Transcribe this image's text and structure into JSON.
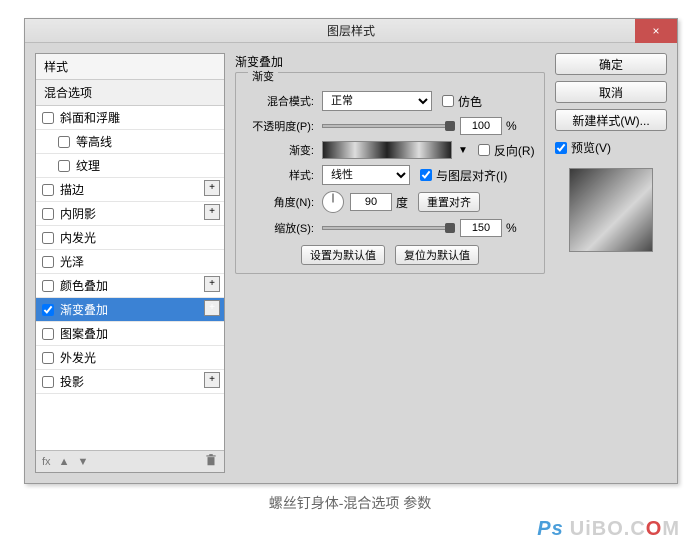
{
  "dialog": {
    "title": "图层样式",
    "close": "×"
  },
  "left": {
    "header": "样式",
    "blend": "混合选项",
    "items": [
      {
        "label": "斜面和浮雕",
        "checked": false,
        "indent": false,
        "plus": false
      },
      {
        "label": "等高线",
        "checked": false,
        "indent": true,
        "plus": false
      },
      {
        "label": "纹理",
        "checked": false,
        "indent": true,
        "plus": false
      },
      {
        "label": "描边",
        "checked": false,
        "indent": false,
        "plus": true
      },
      {
        "label": "内阴影",
        "checked": false,
        "indent": false,
        "plus": true
      },
      {
        "label": "内发光",
        "checked": false,
        "indent": false,
        "plus": false
      },
      {
        "label": "光泽",
        "checked": false,
        "indent": false,
        "plus": false
      },
      {
        "label": "颜色叠加",
        "checked": false,
        "indent": false,
        "plus": true
      },
      {
        "label": "渐变叠加",
        "checked": true,
        "indent": false,
        "plus": true,
        "selected": true
      },
      {
        "label": "图案叠加",
        "checked": false,
        "indent": false,
        "plus": false
      },
      {
        "label": "外发光",
        "checked": false,
        "indent": false,
        "plus": false
      },
      {
        "label": "投影",
        "checked": false,
        "indent": false,
        "plus": true
      }
    ],
    "footer_fx": "fx"
  },
  "mid": {
    "group_title": "渐变叠加",
    "fieldset_title": "渐变",
    "blend_mode_label": "混合模式:",
    "blend_mode_value": "正常",
    "dither_label": "仿色",
    "opacity_label": "不透明度(P):",
    "opacity_value": "100",
    "percent": "%",
    "gradient_label": "渐变:",
    "reverse_label": "反向(R)",
    "style_label": "样式:",
    "style_value": "线性",
    "align_label": "与图层对齐(I)",
    "angle_label": "角度(N):",
    "angle_value": "90",
    "degree": "度",
    "reset_align": "重置对齐",
    "scale_label": "缩放(S):",
    "scale_value": "150",
    "set_default": "设置为默认值",
    "reset_default": "复位为默认值"
  },
  "right": {
    "ok": "确定",
    "cancel": "取消",
    "new_style": "新建样式(W)...",
    "preview_label": "预览(V)"
  },
  "caption": "螺丝钉身体-混合选项 参数",
  "watermark": {
    "ps": "Ps",
    "text1": "UiBO.C",
    "red": "O",
    "text2": "M"
  }
}
